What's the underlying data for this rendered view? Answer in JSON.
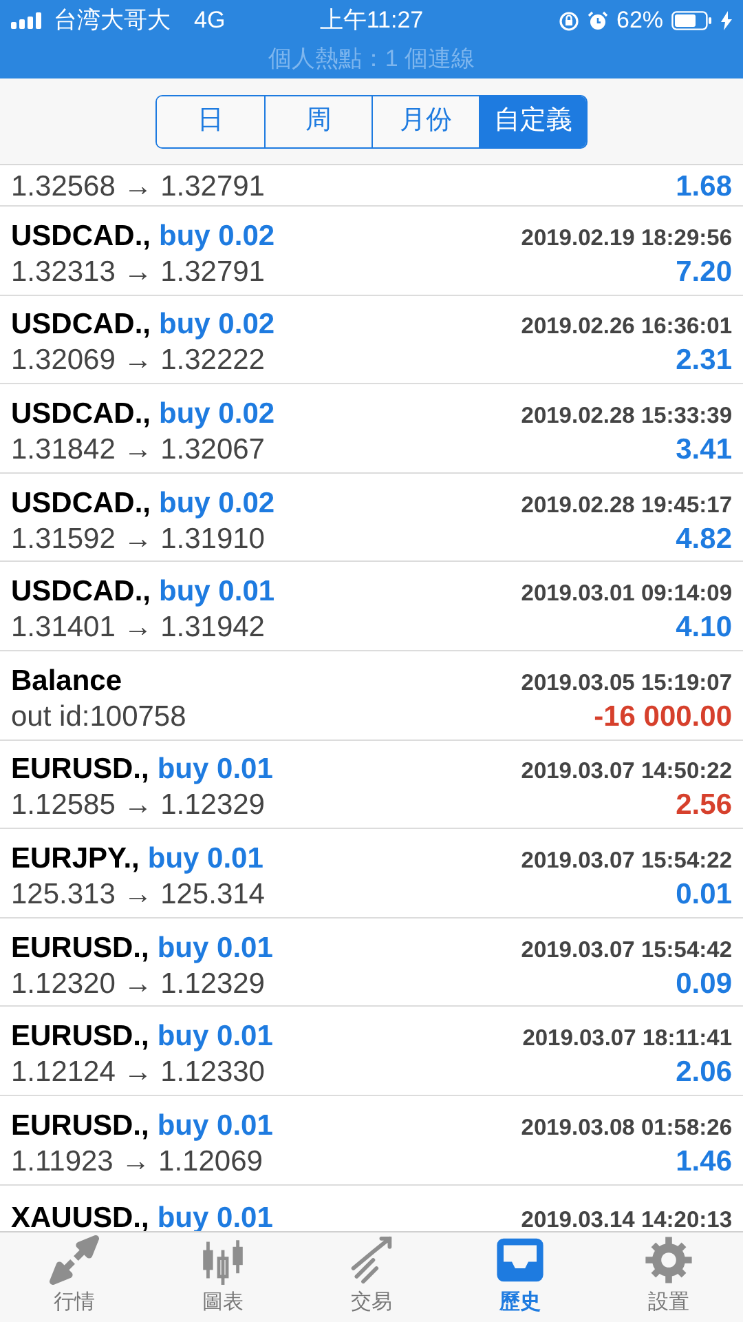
{
  "status_bar": {
    "carrier": "台湾大哥大",
    "network": "4G",
    "time": "上午11:27",
    "battery": "62%",
    "hotspot": "個人熱點：1 個連線"
  },
  "tabs": [
    {
      "label": "日",
      "selected": false
    },
    {
      "label": "周",
      "selected": false
    },
    {
      "label": "月份",
      "selected": false
    },
    {
      "label": "自定義",
      "selected": true
    }
  ],
  "history": [
    {
      "kind": "tail",
      "prices": "1.32568 → 1.32791",
      "profit": "1.68",
      "loss": false
    },
    {
      "kind": "trade",
      "symbol": "USDCAD.,",
      "order": "buy 0.02",
      "time": "2019.02.19 18:29:56",
      "prices": "1.32313 → 1.32791",
      "profit": "7.20",
      "loss": false
    },
    {
      "kind": "trade",
      "symbol": "USDCAD.,",
      "order": "buy 0.02",
      "time": "2019.02.26 16:36:01",
      "prices": "1.32069 → 1.32222",
      "profit": "2.31",
      "loss": false
    },
    {
      "kind": "trade",
      "symbol": "USDCAD.,",
      "order": "buy 0.02",
      "time": "2019.02.28 15:33:39",
      "prices": "1.31842 → 1.32067",
      "profit": "3.41",
      "loss": false
    },
    {
      "kind": "trade",
      "symbol": "USDCAD.,",
      "order": "buy 0.02",
      "time": "2019.02.28 19:45:17",
      "prices": "1.31592 → 1.31910",
      "profit": "4.82",
      "loss": false
    },
    {
      "kind": "trade",
      "symbol": "USDCAD.,",
      "order": "buy 0.01",
      "time": "2019.03.01 09:14:09",
      "prices": "1.31401 → 1.31942",
      "profit": "4.10",
      "loss": false
    },
    {
      "kind": "balance",
      "symbol": "Balance",
      "time": "2019.03.05 15:19:07",
      "prices": "out id:100758",
      "profit": "-16 000.00",
      "loss": true
    },
    {
      "kind": "trade",
      "symbol": "EURUSD.,",
      "order": "buy 0.01",
      "time": "2019.03.07 14:50:22",
      "prices": "1.12585 → 1.12329",
      "profit": "2.56",
      "loss": true
    },
    {
      "kind": "trade",
      "symbol": "EURJPY.,",
      "order": "buy 0.01",
      "time": "2019.03.07 15:54:22",
      "prices": "125.313 → 125.314",
      "profit": "0.01",
      "loss": false
    },
    {
      "kind": "trade",
      "symbol": "EURUSD.,",
      "order": "buy 0.01",
      "time": "2019.03.07 15:54:42",
      "prices": "1.12320 → 1.12329",
      "profit": "0.09",
      "loss": false
    },
    {
      "kind": "trade",
      "symbol": "EURUSD.,",
      "order": "buy 0.01",
      "time": "2019.03.07 18:11:41",
      "prices": "1.12124 → 1.12330",
      "profit": "2.06",
      "loss": false
    },
    {
      "kind": "trade",
      "symbol": "EURUSD.,",
      "order": "buy 0.01",
      "time": "2019.03.08 01:58:26",
      "prices": "1.11923 → 1.12069",
      "profit": "1.46",
      "loss": false
    },
    {
      "kind": "head",
      "symbol": "XAUUSD.,",
      "order": "buy 0.01",
      "time": "2019.03.14 14:20:13"
    }
  ],
  "nav": [
    {
      "label": "行情",
      "selected": false
    },
    {
      "label": "圖表",
      "selected": false
    },
    {
      "label": "交易",
      "selected": false
    },
    {
      "label": "歷史",
      "selected": true
    },
    {
      "label": "設置",
      "selected": false
    }
  ]
}
